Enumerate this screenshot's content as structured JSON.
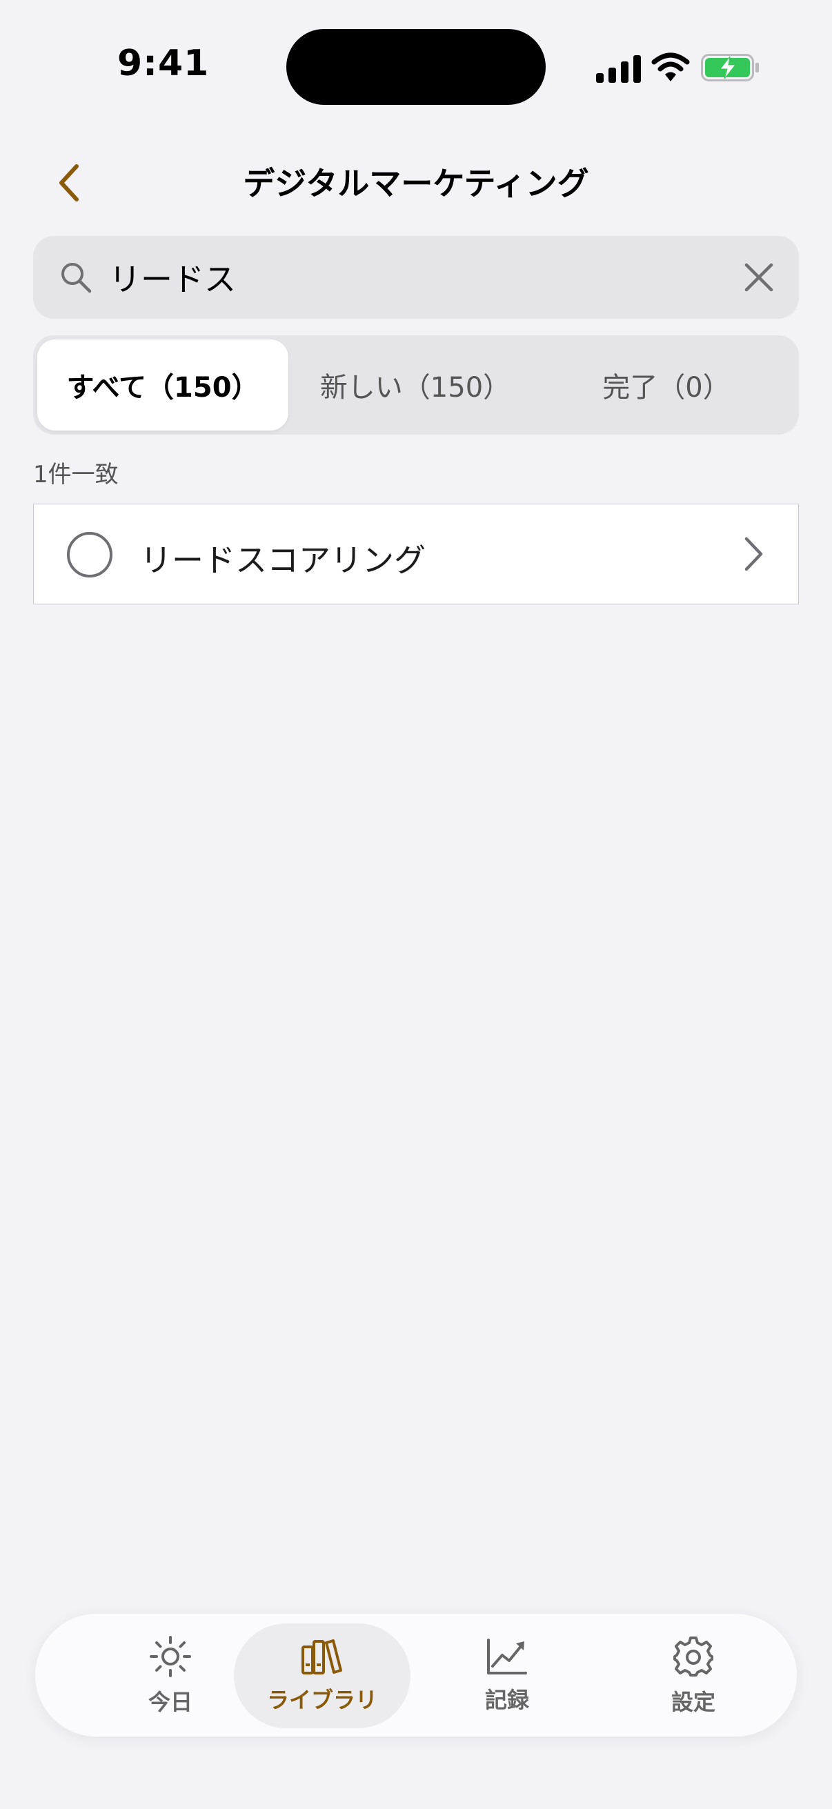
{
  "status_bar": {
    "time": "9:41"
  },
  "nav": {
    "title": "デジタルマーケティング"
  },
  "search": {
    "value": "リードス",
    "placeholder": ""
  },
  "segments": [
    {
      "label": "すべて（150）",
      "active": true
    },
    {
      "label": "新しい（150）",
      "active": false
    },
    {
      "label": "完了（0）",
      "active": false
    }
  ],
  "results": {
    "count_text": "1件一致"
  },
  "items": [
    {
      "label": "リードスコアリング",
      "checked": false
    }
  ],
  "tabbar": {
    "tabs": [
      {
        "label": "今日",
        "icon": "sun-icon",
        "active": false
      },
      {
        "label": "ライブラリ",
        "icon": "books-icon",
        "active": true
      },
      {
        "label": "記録",
        "icon": "chart-icon",
        "active": false
      },
      {
        "label": "設定",
        "icon": "gear-icon",
        "active": false
      }
    ]
  },
  "colors": {
    "accent": "#8a5a08",
    "background": "#f2f2f7",
    "battery": "#34c759"
  }
}
